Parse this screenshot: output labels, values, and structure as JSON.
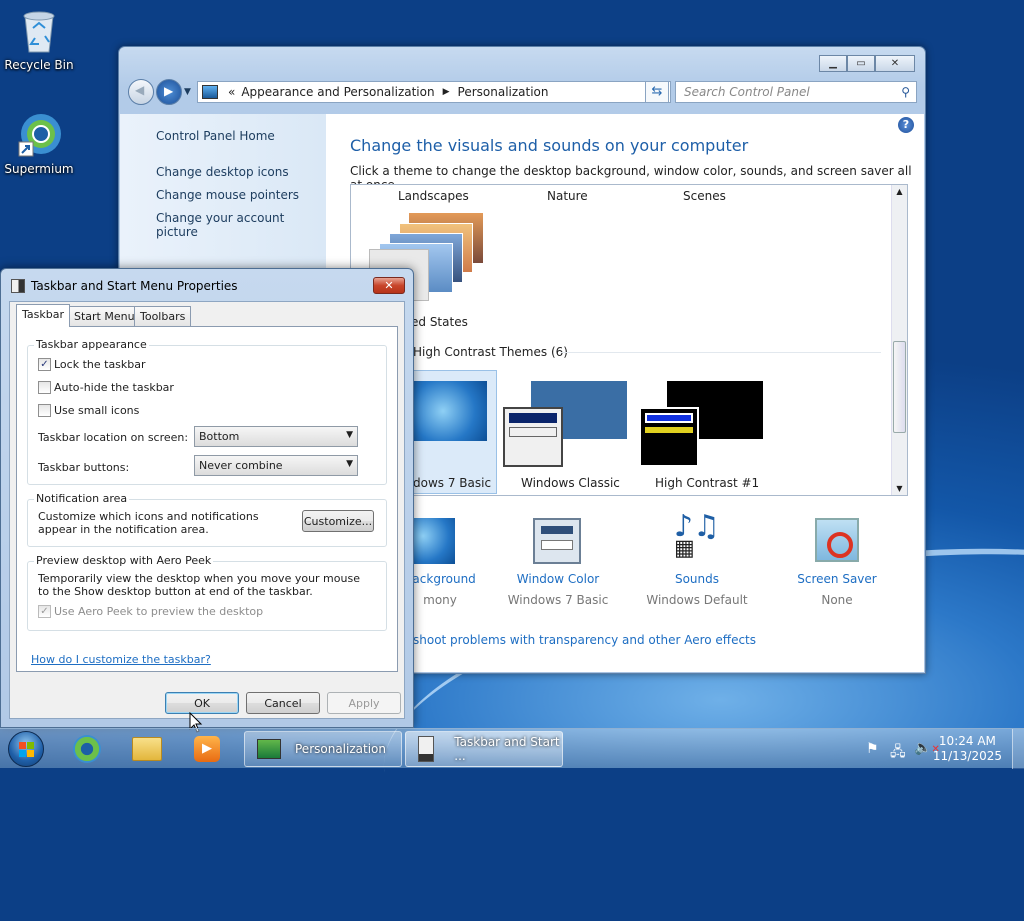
{
  "desktop": {
    "icons": [
      {
        "label": "Recycle Bin",
        "icon": "recycle-bin-icon"
      },
      {
        "label": "Supermium",
        "icon": "supermium-browser-icon"
      }
    ]
  },
  "control_panel": {
    "address": {
      "chevrons": "«",
      "crumbs": [
        "Appearance and Personalization",
        "Personalization"
      ]
    },
    "search_placeholder": "Search Control Panel",
    "sidebar": {
      "home": "Control Panel Home",
      "links": [
        "Change desktop icons",
        "Change mouse pointers",
        "Change your account picture"
      ]
    },
    "heading": "Change the visuals and sounds on your computer",
    "subheading": "Click a theme to change the desktop background, window color, sounds, and screen saver all at once.",
    "theme_row1": [
      "Landscapes",
      "Nature",
      "Scenes"
    ],
    "partial_theme_label": "ed States",
    "high_contrast_heading": "High Contrast Themes (6)",
    "theme_row2": [
      "dows 7 Basic",
      "Windows Classic",
      "High Contrast #1"
    ],
    "bottom_items": [
      {
        "title": "Background",
        "sub": "mony"
      },
      {
        "title": "Window Color",
        "sub": "Windows 7 Basic"
      },
      {
        "title": "Sounds",
        "sub": "Windows Default"
      },
      {
        "title": "Screen Saver",
        "sub": "None"
      }
    ],
    "troubleshoot_link": "shoot problems with transparency and other Aero effects"
  },
  "dialog": {
    "title": "Taskbar and Start Menu Properties",
    "tabs": [
      "Taskbar",
      "Start Menu",
      "Toolbars"
    ],
    "appearance": {
      "title": "Taskbar appearance",
      "lock": "Lock the taskbar",
      "autohide": "Auto-hide the taskbar",
      "small": "Use small icons",
      "location_label": "Taskbar location on screen:",
      "location_value": "Bottom",
      "buttons_label": "Taskbar buttons:",
      "buttons_value": "Never combine"
    },
    "notification": {
      "title": "Notification area",
      "text": "Customize which icons and notifications appear in the notification area.",
      "button": "Customize..."
    },
    "peek": {
      "title": "Preview desktop with Aero Peek",
      "text": "Temporarily view the desktop when you move your mouse to the Show desktop button at end of the taskbar.",
      "checkbox": "Use Aero Peek to preview the desktop"
    },
    "help_link": "How do I customize the taskbar?",
    "ok": "OK",
    "cancel": "Cancel",
    "apply": "Apply",
    "close_glyph": "✕"
  },
  "taskbar": {
    "tasks": [
      "Personalization",
      "Taskbar and Start ..."
    ],
    "time": "10:24 AM",
    "date": "11/13/2025"
  }
}
